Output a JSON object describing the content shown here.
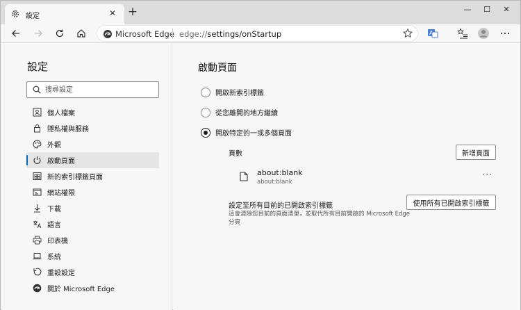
{
  "window": {
    "tab_title": "設定",
    "close_glyph": "✕",
    "new_tab_glyph": "+",
    "minimize_glyph": "—",
    "maximize_glyph": "☐",
    "close_window_glyph": "✕"
  },
  "toolbar": {
    "site_name": "Microsoft Edge",
    "url_prefix": "edge://",
    "url_path": "settings/onStartup"
  },
  "sidebar": {
    "title": "設定",
    "search_placeholder": "搜尋設定",
    "items": [
      {
        "label": "個人檔案",
        "icon": "profile-icon"
      },
      {
        "label": "隱私權與服務",
        "icon": "lock-icon"
      },
      {
        "label": "外觀",
        "icon": "palette-icon"
      },
      {
        "label": "啟動頁面",
        "icon": "power-icon",
        "active": true
      },
      {
        "label": "新的索引標籤頁面",
        "icon": "new-tab-page-icon"
      },
      {
        "label": "網站權限",
        "icon": "site-permissions-icon"
      },
      {
        "label": "下載",
        "icon": "download-icon"
      },
      {
        "label": "語言",
        "icon": "language-icon"
      },
      {
        "label": "印表機",
        "icon": "printer-icon"
      },
      {
        "label": "系統",
        "icon": "laptop-icon"
      },
      {
        "label": "重設設定",
        "icon": "reset-icon"
      },
      {
        "label": "關於 Microsoft Edge",
        "icon": "edge-logo-icon"
      }
    ]
  },
  "main": {
    "title": "啟動頁面",
    "options": [
      {
        "label": "開啟新索引標籤",
        "checked": false
      },
      {
        "label": "從您離開的地方繼續",
        "checked": false
      },
      {
        "label": "開啟特定的一或多個頁面",
        "checked": true
      }
    ],
    "pages_label": "頁數",
    "add_page_button": "新增頁面",
    "page_entry": {
      "title": "about:blank",
      "url": "about:blank",
      "more": "···"
    },
    "set_all_title": "設定至所有目前的已開啟索引標籤",
    "set_all_desc": "這會清除您目前的頁面清單，並取代所有目前開啟的 Microsoft Edge 分頁",
    "use_all_button": "使用所有已開啟索引標籤"
  },
  "colors": {
    "accent": "#0067b8",
    "titlebar": "#dcdcdc",
    "background": "#f7f7f7"
  }
}
